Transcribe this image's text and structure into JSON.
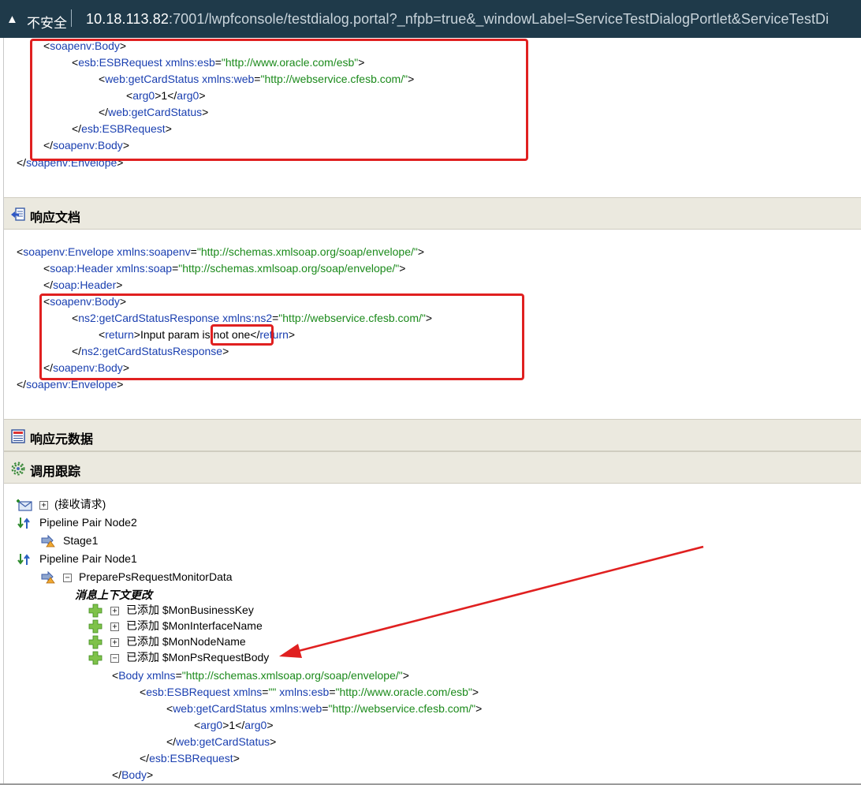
{
  "address_bar": {
    "insecure_label": "不安全",
    "url_host": "10.18.113.82",
    "url_rest": ":7001/lwpfconsole/testdialog.portal?_nfpb=true&_windowLabel=ServiceTestDialogPortlet&ServiceTestDi"
  },
  "request_xml": {
    "lines": [
      {
        "open": "<",
        "tag": "soapenv:Body",
        "close": ">"
      },
      {
        "open": "<",
        "tag": "esb:ESBRequest",
        "attr": "xmlns:esb",
        "eq": "=",
        "val": "\"http://www.oracle.com/esb\"",
        "close": ">"
      },
      {
        "open": "<",
        "tag": "web:getCardStatus",
        "attr": "xmlns:web",
        "eq": "=",
        "val": "\"http://webservice.cfesb.com/\"",
        "close": ">"
      },
      {
        "open": "<",
        "tag": "arg0",
        "close": ">",
        "text": "1",
        "open2": "</",
        "tag2": "arg0",
        "close2": ">"
      },
      {
        "open": "</",
        "tag": "web:getCardStatus",
        "close": ">"
      },
      {
        "open": "</",
        "tag": "esb:ESBRequest",
        "close": ">"
      },
      {
        "open": "</",
        "tag": "soapenv:Body",
        "close": ">"
      },
      {
        "open": "</",
        "tag": "soapenv:Envelope",
        "close": ">"
      }
    ]
  },
  "sections": {
    "response_doc": "响应文档",
    "response_meta": "响应元数据",
    "call_trace": "调用跟踪"
  },
  "response_xml": {
    "lines": [
      {
        "open": "<",
        "tag": "soapenv:Envelope",
        "attr": "xmlns:soapenv",
        "eq": "=",
        "val": "\"http://schemas.xmlsoap.org/soap/envelope/\"",
        "close": ">"
      },
      {
        "open": "<",
        "tag": "soap:Header",
        "attr": "xmlns:soap",
        "eq": "=",
        "val": "\"http://schemas.xmlsoap.org/soap/envelope/\"",
        "close": ">"
      },
      {
        "open": "</",
        "tag": "soap:Header",
        "close": ">"
      },
      {
        "open": "<",
        "tag": "soapenv:Body",
        "close": ">"
      },
      {
        "open": "<",
        "tag": "ns2:getCardStatusResponse",
        "attr": "xmlns:ns2",
        "eq": "=",
        "val": "\"http://webservice.cfesb.com/\"",
        "close": ">"
      },
      {
        "open": "<",
        "tag": "return",
        "close": ">",
        "text": "Input param is not one",
        "open2": "</",
        "tag2": "return",
        "close2": ">"
      },
      {
        "open": "</",
        "tag": "ns2:getCardStatusResponse",
        "close": ">"
      },
      {
        "open": "</",
        "tag": "soapenv:Body",
        "close": ">"
      },
      {
        "open": "</",
        "tag": "soapenv:Envelope",
        "close": ">"
      }
    ]
  },
  "trace": {
    "receive_request": "(接收请求)",
    "node2": "Pipeline Pair Node2",
    "stage1": "Stage1",
    "node1": "Pipeline Pair Node1",
    "prepare": "PreparePsRequestMonitorData",
    "context_changes": "消息上下文更改",
    "added": [
      {
        "label": "已添加 $MonBusinessKey",
        "expander": "+"
      },
      {
        "label": "已添加 $MonInterfaceName",
        "expander": "+"
      },
      {
        "label": "已添加 $MonNodeName",
        "expander": "+"
      },
      {
        "label": "已添加 $MonPsRequestBody",
        "expander": "−"
      }
    ],
    "expand_plus": "+",
    "expand_minus": "−"
  },
  "body_xml": {
    "lines": [
      {
        "open": "<",
        "tag": "Body",
        "attr": "xmlns",
        "eq": "=",
        "val": "\"http://schemas.xmlsoap.org/soap/envelope/\"",
        "close": ">"
      },
      {
        "open": "<",
        "tag": "esb:ESBRequest",
        "attr": "xmlns",
        "eq": "=",
        "val": "\"\"",
        "attr2": "xmlns:esb",
        "eq2": "=",
        "val2": "\"http://www.oracle.com/esb\"",
        "close": ">"
      },
      {
        "open": "<",
        "tag": "web:getCardStatus",
        "attr": "xmlns:web",
        "eq": "=",
        "val": "\"http://webservice.cfesb.com/\"",
        "close": ">"
      },
      {
        "open": "<",
        "tag": "arg0",
        "close": ">",
        "text": "1",
        "open2": "</",
        "tag2": "arg0",
        "close2": ">"
      },
      {
        "open": "</",
        "tag": "web:getCardStatus",
        "close": ">"
      },
      {
        "open": "</",
        "tag": "esb:ESBRequest",
        "close": ">"
      },
      {
        "open": "</",
        "tag": "Body",
        "close": ">"
      }
    ]
  },
  "colors": {
    "tag": "#1a3fb0",
    "attr_value": "#1b8a1b",
    "annotation_red": "#e02020",
    "section_bg": "#ebe9df",
    "address_bar_bg": "#1f3a4a"
  }
}
